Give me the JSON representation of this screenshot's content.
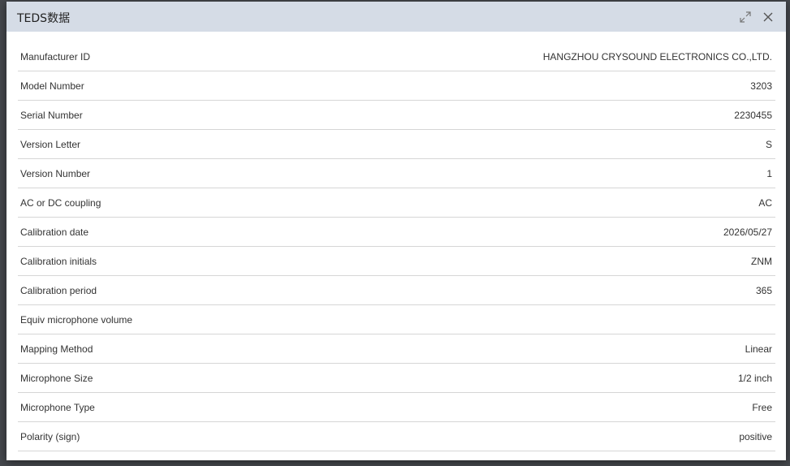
{
  "dialog": {
    "title": "TEDS数据",
    "expand_icon": "expand-icon",
    "close_icon": "close-icon"
  },
  "rows": [
    {
      "label": "Manufacturer ID",
      "value": "HANGZHOU CRYSOUND ELECTRONICS CO.,LTD."
    },
    {
      "label": "Model Number",
      "value": "3203"
    },
    {
      "label": "Serial Number",
      "value": "2230455"
    },
    {
      "label": "Version Letter",
      "value": "S"
    },
    {
      "label": "Version Number",
      "value": "1"
    },
    {
      "label": "AC or DC coupling",
      "value": "AC"
    },
    {
      "label": "Calibration date",
      "value": "2026/05/27"
    },
    {
      "label": "Calibration initials",
      "value": "ZNM"
    },
    {
      "label": "Calibration period",
      "value": "365"
    },
    {
      "label": "Equiv microphone volume",
      "value": ""
    },
    {
      "label": "Mapping Method",
      "value": "Linear"
    },
    {
      "label": "Microphone Size",
      "value": "1/2 inch"
    },
    {
      "label": "Microphone Type",
      "value": "Free"
    },
    {
      "label": "Polarity (sign)",
      "value": "positive"
    }
  ]
}
